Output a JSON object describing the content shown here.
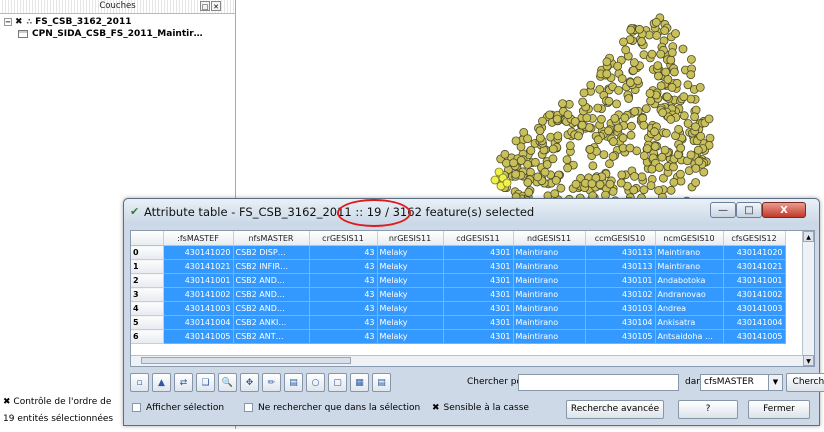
{
  "layers_panel": {
    "title": "Couches",
    "layers": [
      {
        "name": "FS_CSB_3162_2011"
      },
      {
        "name": "CPN_SIDA_CSB_FS_2011_Maintir…"
      }
    ],
    "render_order_label": "Contrôle de l'ordre de",
    "selected_count_label": "19 entités sélectionnées"
  },
  "attribute_window": {
    "title": "Attribute table - FS_CSB_3162_2011 :: 19 / 3162 feature(s) selected",
    "minimize": "—",
    "maximize": "□",
    "close": "X",
    "columns": [
      "",
      ":fsMASTEF",
      "nfsMASTER",
      "crGESIS11",
      "nrGESIS11",
      "cdGESIS11",
      "ndGESIS11",
      "ccmGESIS10",
      "ncmGESIS10",
      "cfsGESIS12"
    ],
    "rows": [
      [
        "0",
        "430141020",
        "CSB2 DISP…",
        "43",
        "Melaky",
        "4301",
        "Maintirano",
        "430113",
        "Maintirano",
        "430141020"
      ],
      [
        "1",
        "430141021",
        "CSB2 INFIR…",
        "43",
        "Melaky",
        "4301",
        "Maintirano",
        "430113",
        "Maintirano",
        "430141021"
      ],
      [
        "2",
        "430141001",
        "CSB2 AND…",
        "43",
        "Melaky",
        "4301",
        "Maintirano",
        "430101",
        "Andabotoka",
        "430141001"
      ],
      [
        "3",
        "430141002",
        "CSB2 AND…",
        "43",
        "Melaky",
        "4301",
        "Maintirano",
        "430102",
        "Andranovao",
        "430141002"
      ],
      [
        "4",
        "430141003",
        "CSB2 AND…",
        "43",
        "Melaky",
        "4301",
        "Maintirano",
        "430103",
        "Andrea",
        "430141003"
      ],
      [
        "5",
        "430141004",
        "CSB2 ANKI…",
        "43",
        "Melaky",
        "4301",
        "Maintirano",
        "430104",
        "Ankisatra",
        "430141004"
      ],
      [
        "6",
        "430141005",
        "CSB2 ANT…",
        "43",
        "Melaky",
        "4301",
        "Maintirano",
        "430105",
        "Antsaidoha …",
        "430141005"
      ]
    ],
    "search_label": "Chercher pour",
    "search_value": "",
    "in_label": "dans",
    "field_selected": "cfsMASTER",
    "search_button": "Chercher",
    "show_selection_label": "Afficher sélection",
    "search_selection_only_label": "Ne rechercher que dans la sélection",
    "case_sensitive_label": "Sensible à la casse",
    "advanced_search_button": "Recherche avancée",
    "help_button": "?",
    "close_button": "Fermer"
  },
  "colors": {
    "selection": "#3399ff",
    "points": "#c9c05a",
    "highlight_points": "#f0f04a",
    "annotation_circle": "#e01b1b"
  }
}
